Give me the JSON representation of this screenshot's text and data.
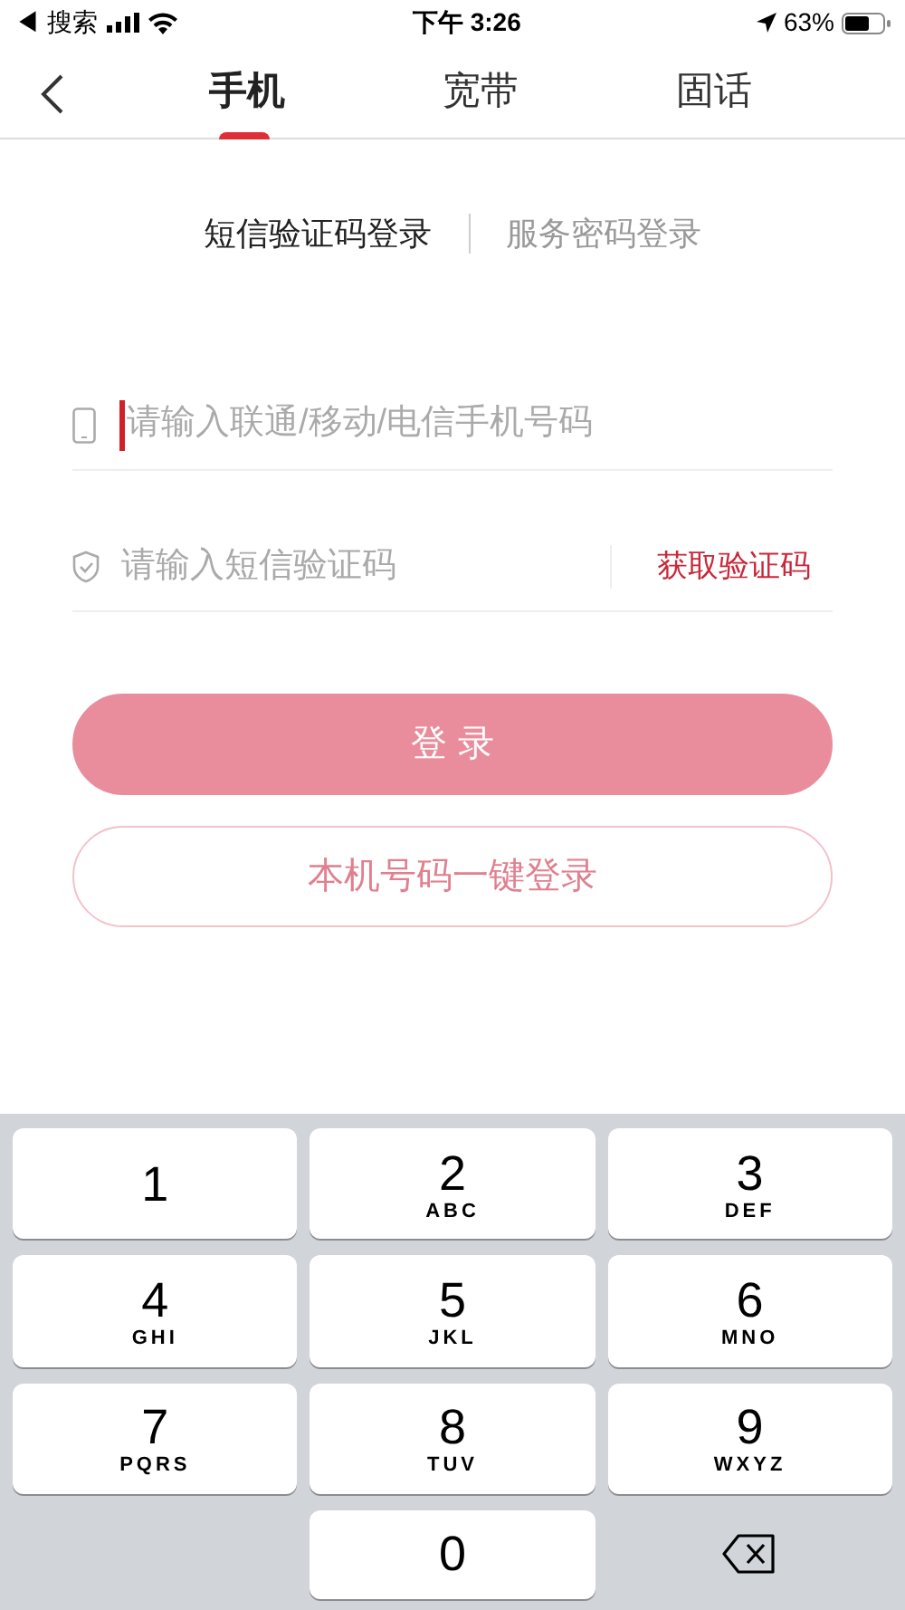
{
  "status_bar": {
    "back_app": "◀ 搜索",
    "time": "下午 3:26",
    "battery": "63%"
  },
  "tabs": [
    {
      "label": "手机",
      "selected": true
    },
    {
      "label": "宽带",
      "selected": false
    },
    {
      "label": "固话",
      "selected": false
    }
  ],
  "login_modes": [
    {
      "label": "短信验证码登录",
      "selected": true
    },
    {
      "label": "服务密码登录",
      "selected": false
    }
  ],
  "phone_field": {
    "placeholder": "请输入联通/移动/电信手机号码",
    "focused": true
  },
  "code_field": {
    "placeholder": "请输入短信验证码",
    "action": "获取验证码"
  },
  "buttons": [
    {
      "label": "登 录",
      "kind": "filled"
    },
    {
      "label": "本机号码一键登录",
      "kind": "outline"
    }
  ],
  "keyboard": [
    {
      "kind": "digit",
      "digit": "1"
    },
    {
      "kind": "digit",
      "digit": "2",
      "letters": "ABC"
    },
    {
      "kind": "digit",
      "digit": "3",
      "letters": "DEF"
    },
    {
      "kind": "digit",
      "digit": "4",
      "letters": "GHI"
    },
    {
      "kind": "digit",
      "digit": "5",
      "letters": "JKL"
    },
    {
      "kind": "digit",
      "digit": "6",
      "letters": "MNO"
    },
    {
      "kind": "digit",
      "digit": "7",
      "letters": "PQRS"
    },
    {
      "kind": "digit",
      "digit": "8",
      "letters": "TUV"
    },
    {
      "kind": "digit",
      "digit": "9",
      "letters": "WXYZ"
    },
    {
      "kind": "blank"
    },
    {
      "kind": "digit",
      "digit": "0"
    },
    {
      "kind": "delete"
    }
  ]
}
